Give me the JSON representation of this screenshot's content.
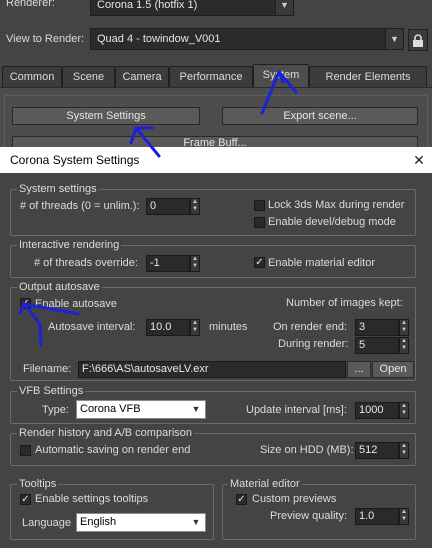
{
  "top": {
    "renderer_label": "Renderer:",
    "renderer_value": "Corona 1.5 (hotfix 1)",
    "view_label": "View to Render:",
    "view_value": "Quad 4 - towindow_V001",
    "lock_icon": "lock-icon"
  },
  "tabs": [
    "Common",
    "Scene",
    "Camera",
    "Performance",
    "System",
    "Render Elements"
  ],
  "active_tab": "System",
  "system_tab": {
    "system_settings_button": "System Settings",
    "export_scene_button": "Export scene...",
    "partial_button": "Frame Buff..."
  },
  "dialog": {
    "title": "Corona System Settings",
    "close": "✕",
    "system_settings": {
      "title": "System settings",
      "threads_label": "# of threads (0 = unlim.):",
      "threads_value": "0",
      "lock_label": "Lock 3ds Max during render",
      "devel_label": "Enable devel/debug mode"
    },
    "interactive": {
      "title": "Interactive rendering",
      "threads_label": "# of threads override:",
      "threads_value": "-1",
      "material_editor_label": "Enable material editor",
      "material_editor_checked": true
    },
    "autosave": {
      "title": "Output autosave",
      "enable_label": "Enable autosave",
      "enable_checked": true,
      "interval_label": "Autosave interval:",
      "interval_value": "10.0",
      "interval_unit": "minutes",
      "images_kept_label": "Number of images kept:",
      "on_render_end_label": "On render end:",
      "on_render_end_value": "3",
      "during_render_label": "During render:",
      "during_render_value": "5",
      "filename_label": "Filename:",
      "filename_value": "F:\\666\\AS\\autosaveLV.exr",
      "browse_label": "...",
      "open_label": "Open"
    },
    "vfb": {
      "title": "VFB Settings",
      "type_label": "Type:",
      "type_value": "Corona VFB",
      "update_label": "Update interval [ms]:",
      "update_value": "1000"
    },
    "history": {
      "title": "Render history and A/B comparison",
      "auto_save_label": "Automatic saving on render end",
      "size_label": "Size on HDD (MB):",
      "size_value": "512"
    },
    "tooltips": {
      "title": "Tooltips",
      "enable_label": "Enable settings tooltips",
      "enable_checked": true,
      "language_label": "Language",
      "language_value": "English"
    },
    "material_editor": {
      "title": "Material editor",
      "custom_label": "Custom previews",
      "custom_checked": true,
      "quality_label": "Preview quality:",
      "quality_value": "1.0"
    }
  },
  "colors": {
    "annotation": "#1b22d9",
    "panel": "#444444",
    "titlebar": "#ffffff"
  }
}
